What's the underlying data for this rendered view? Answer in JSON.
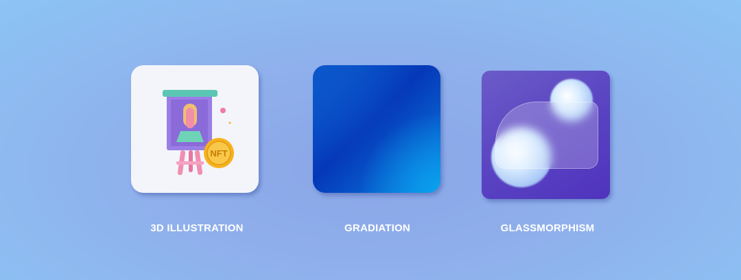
{
  "cards": [
    {
      "label": "3D ILLUSTRATION",
      "illustration": "easel-nft-icon"
    },
    {
      "label": "GRADIATION",
      "colors": [
        "#0538b8",
        "#0aa2ee"
      ]
    },
    {
      "label": "GLASSMORPHISM",
      "colors": [
        "#5a44c2",
        "#ffffff"
      ]
    }
  ],
  "nft_coin_text": "NFT"
}
